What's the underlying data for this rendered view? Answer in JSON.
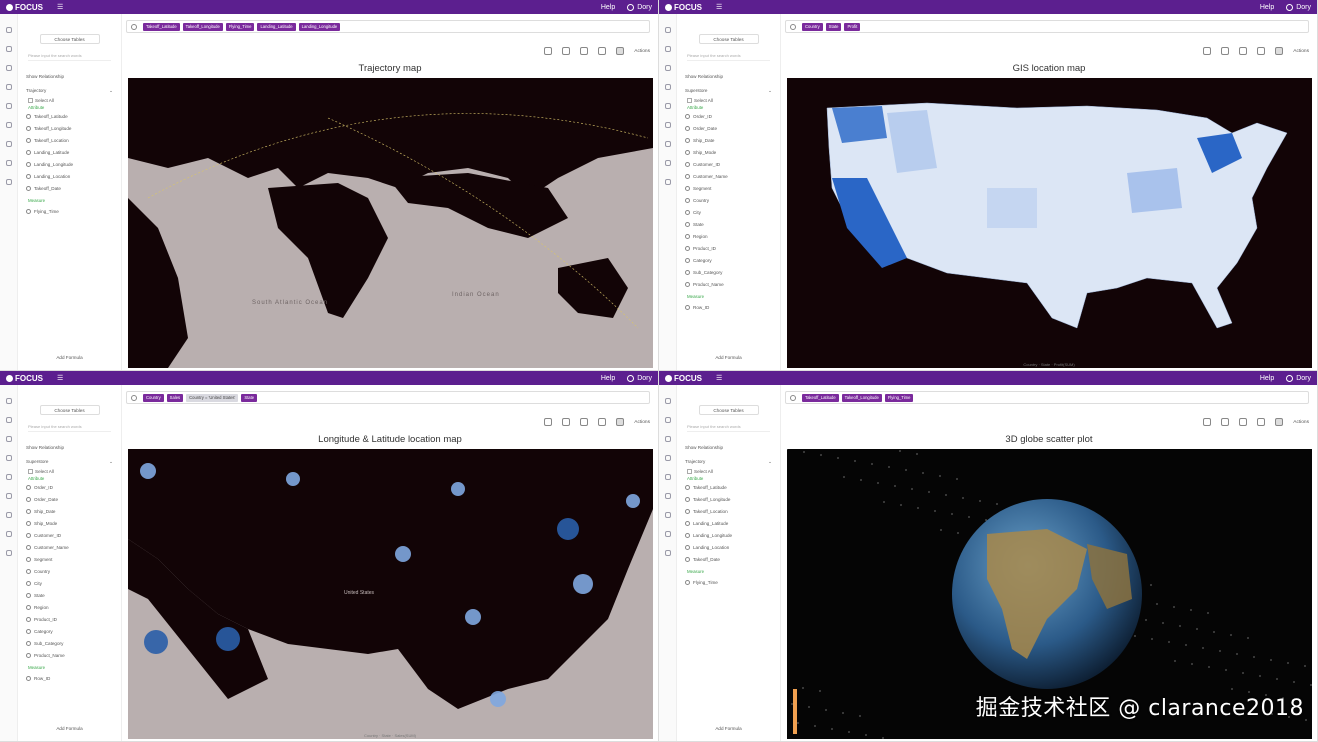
{
  "app": {
    "logo": "FOCUS",
    "help": "Help",
    "user": "Dory"
  },
  "shared": {
    "choose_tables": "Choose Tables",
    "search_placeholder": "Please input the search words",
    "show_relationship": "Show Relationship",
    "select_all": "Select All",
    "attribute": "Attribute",
    "measure": "Measure",
    "add_formula": "Add Formula",
    "actions": "Actions"
  },
  "panels": [
    {
      "tokens": [
        "Takeoff_Latitude",
        "Takeoff_Longitude",
        "Flying_Time",
        "Landing_Latitude",
        "Landing_Longitude"
      ],
      "title": "Trajectory map",
      "table": "Trajectory",
      "fields": [
        "Takeoff_Latitude",
        "Takeoff_Longitude",
        "Takeoff_Location",
        "Landing_Latitude",
        "Landing_Longitude",
        "Landing_Location",
        "Takeoff_Date"
      ],
      "measures": [
        "Flying_Time"
      ],
      "map_labels": [
        "South Atlantic Ocean",
        "Indian Ocean"
      ]
    },
    {
      "tokens": [
        "Country",
        "State",
        "Profit"
      ],
      "title": "GIS location map",
      "table": "Superstore",
      "fields": [
        "Order_ID",
        "Order_Date",
        "Ship_Date",
        "Ship_Mode",
        "Customer_ID",
        "Customer_Name",
        "Segment",
        "Country",
        "City",
        "State",
        "Region",
        "Product_ID",
        "Category",
        "Sub_Category",
        "Product_Name"
      ],
      "measures": [
        "Row_ID"
      ],
      "caption": "Country · State · Profit(SUM)"
    },
    {
      "tokens": [
        "Country",
        "Sales",
        "Country = 'United States'",
        "State"
      ],
      "title": "Longitude & Latitude location map",
      "table": "Superstore",
      "fields": [
        "Order_ID",
        "Order_Date",
        "Ship_Date",
        "Ship_Mode",
        "Customer_ID",
        "Customer_Name",
        "Segment",
        "Country",
        "City",
        "State",
        "Region",
        "Product_ID",
        "Category",
        "Sub_Category",
        "Product_Name"
      ],
      "measures": [
        "Row_ID"
      ],
      "caption": "Country · State · Sales(SUM)",
      "map_label": "United States"
    },
    {
      "tokens": [
        "Takeoff_Latitude",
        "Takeoff_Longitude",
        "Flying_Time"
      ],
      "title": "3D globe scatter plot",
      "table": "Trajectory",
      "fields": [
        "Takeoff_Latitude",
        "Takeoff_Longitude",
        "Takeoff_Location",
        "Landing_Latitude",
        "Landing_Longitude",
        "Landing_Location",
        "Takeoff_Date"
      ],
      "measures": [
        "Flying_Time"
      ]
    }
  ],
  "watermark": "掘金技术社区 @ clarance2018"
}
